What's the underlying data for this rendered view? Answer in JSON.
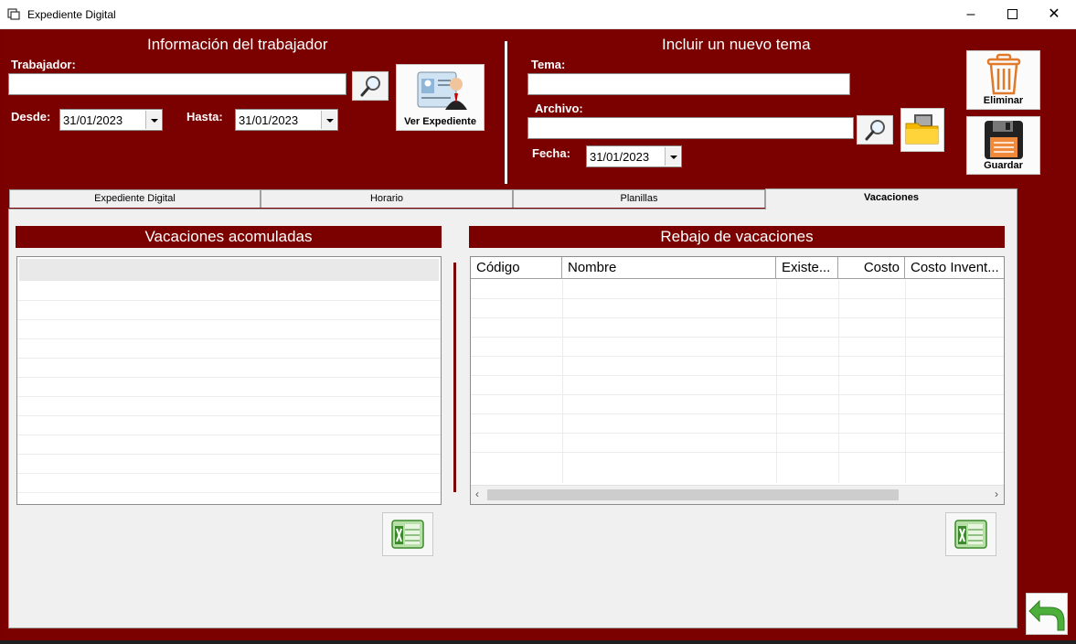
{
  "window": {
    "title": "Expediente Digital"
  },
  "worker": {
    "header": "Información del trabajador",
    "trabajador_label": "Trabajador:",
    "trabajador_value": "",
    "desde_label": "Desde:",
    "desde_value": "31/01/2023",
    "hasta_label": "Hasta:",
    "hasta_value": "31/01/2023",
    "ver_expediente_label": "Ver Expediente"
  },
  "new_topic": {
    "header": "Incluir un nuevo tema",
    "tema_label": "Tema:",
    "tema_value": "",
    "archivo_label": "Archivo:",
    "archivo_value": "",
    "fecha_label": "Fecha:",
    "fecha_value": "31/01/2023"
  },
  "actions": {
    "eliminar_label": "Eliminar",
    "guardar_label": "Guardar"
  },
  "tabs": [
    {
      "label": "Expediente Digital"
    },
    {
      "label": "Horario"
    },
    {
      "label": "Planillas"
    },
    {
      "label": "Vacaciones",
      "active": true
    }
  ],
  "accumulated": {
    "header": "Vacaciones acomuladas"
  },
  "deduction": {
    "header": "Rebajo de vacaciones",
    "columns": [
      "Código",
      "Nombre",
      "Existe...",
      "Costo",
      "Costo Invent..."
    ]
  },
  "colors": {
    "brand": "#7b0000",
    "panel": "#f0f0f0",
    "excel_green": "#3a8a2a",
    "return_green": "#4caf3a"
  },
  "icons": [
    "search-icon",
    "employee-profile-icon",
    "trash-icon",
    "floppy-disk-icon",
    "folder-icon",
    "excel-icon",
    "return-arrow-icon"
  ]
}
